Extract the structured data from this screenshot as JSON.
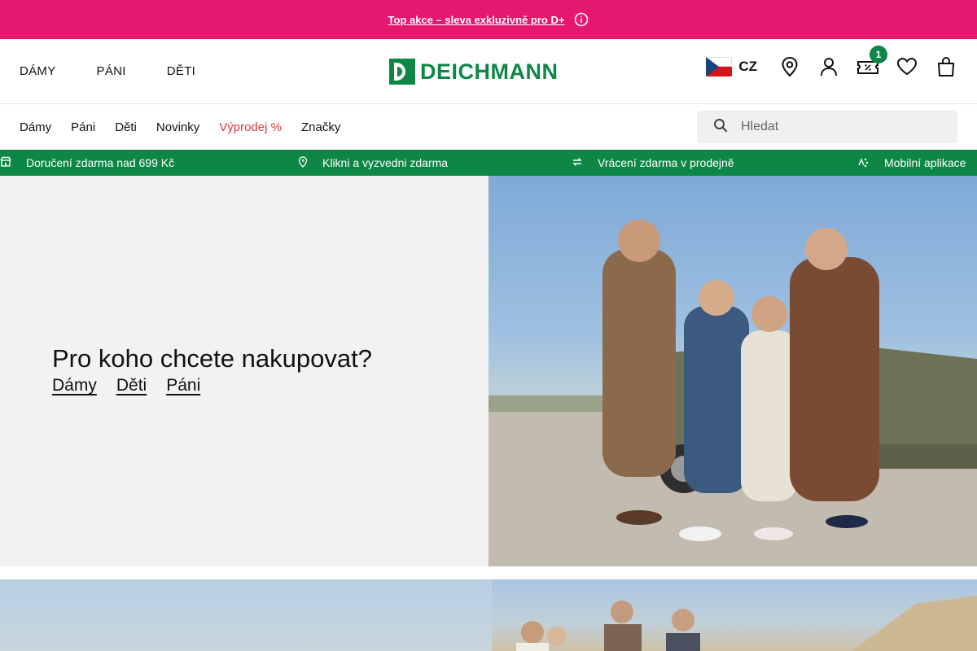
{
  "promo": {
    "text": "Top akce – sleva exkluzivně pro D+",
    "icon": "info-icon"
  },
  "header": {
    "top_nav": [
      "DÁMY",
      "PÁNI",
      "DĚTI"
    ],
    "logo_text": "DEICHMANN",
    "country": "CZ",
    "coupon_count": "1"
  },
  "catnav": {
    "items": [
      "Dámy",
      "Páni",
      "Děti",
      "Novinky",
      "Výprodej %",
      "Značky"
    ],
    "search_placeholder": "Hledat"
  },
  "usp": [
    {
      "icon": "store-icon",
      "text": "Doručení zdarma nad 699 Kč"
    },
    {
      "icon": "location-icon",
      "text": "Klikni a vyzvedni zdarma"
    },
    {
      "icon": "return-icon",
      "text": "Vrácení zdarma v prodejně"
    },
    {
      "icon": "app-icon",
      "text": "Mobilní aplikace"
    }
  ],
  "hero": {
    "title": "Pro koho chcete nakupovat?",
    "links": [
      "Dámy",
      "Děti",
      "Páni"
    ]
  },
  "colors": {
    "promo": "#e6176f",
    "brand": "#0e8746",
    "sale": "#d93a3a",
    "hero_bg": "#f2f2f2"
  }
}
